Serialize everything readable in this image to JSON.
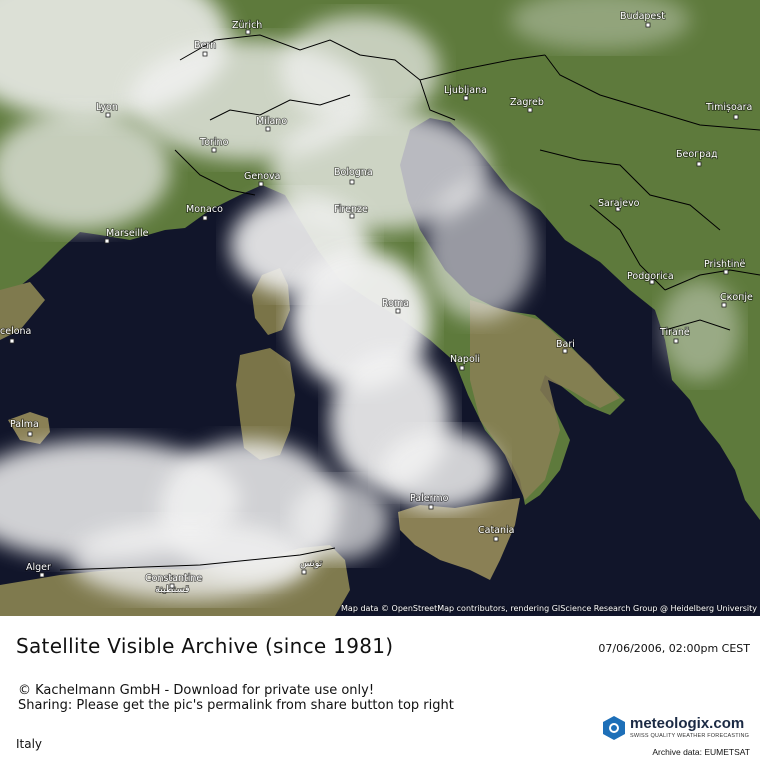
{
  "map": {
    "attribution": "Map data © OpenStreetMap contributors, rendering GIScience Research Group @ Heidelberg University",
    "cities": [
      {
        "name": "Zürich"
      },
      {
        "name": "Bern"
      },
      {
        "name": "Lyon"
      },
      {
        "name": "Milano"
      },
      {
        "name": "Torino"
      },
      {
        "name": "Genova"
      },
      {
        "name": "Bologna"
      },
      {
        "name": "Monaco"
      },
      {
        "name": "Marseille"
      },
      {
        "name": "Firenze"
      },
      {
        "name": "Roma"
      },
      {
        "name": "Napoli"
      },
      {
        "name": "Bari"
      },
      {
        "name": "Palermo"
      },
      {
        "name": "Catania"
      },
      {
        "name": "Palma"
      },
      {
        "name": "celona"
      },
      {
        "name": "Alger"
      },
      {
        "name": "Constantine"
      },
      {
        "name": "قسنطينة"
      },
      {
        "name": "تونس"
      },
      {
        "name": "Budapest"
      },
      {
        "name": "Ljubljana"
      },
      {
        "name": "Zagreb"
      },
      {
        "name": "Timișoara"
      },
      {
        "name": "Београд"
      },
      {
        "name": "Sarajevo"
      },
      {
        "name": "Podgorica"
      },
      {
        "name": "Prishtinë"
      },
      {
        "name": "Скопје"
      },
      {
        "name": "Tiranë"
      }
    ]
  },
  "footer": {
    "title": "Satellite Visible Archive (since 1981)",
    "datetime": "07/06/2006, 02:00pm CEST",
    "copyright_line1": "© Kachelmann GmbH - Download for private use only!",
    "copyright_line2": "Sharing: Please get the pic's permalink from share button top right",
    "region": "Italy",
    "logo_name": "meteologix.com",
    "logo_tagline": "SWISS QUALITY WEATHER FORECASTING",
    "archive_credit": "Archive data: EUMETSAT"
  },
  "colors": {
    "sea": "#11152a",
    "land": "#5e7a3c",
    "land_dry": "#8a8055",
    "cloud": "#f2f2f2",
    "border": "#000000"
  }
}
